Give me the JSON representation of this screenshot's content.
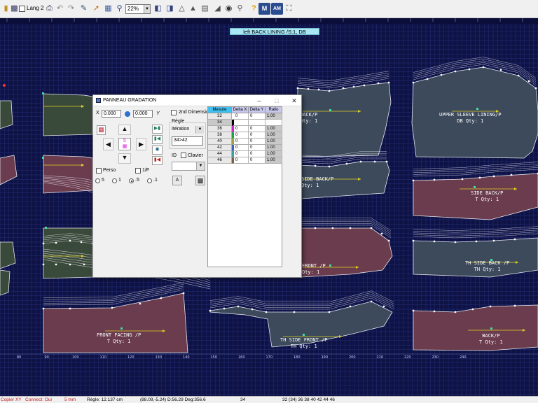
{
  "toolbar": {
    "lang_label": "Lang 2",
    "zoom_value": "22%",
    "m_label": "M",
    "am_label": "AM",
    "help_label": "?"
  },
  "canvas": {
    "top_label": "left BACK LINING /S:1, DB",
    "ruler_bottom": [
      "80",
      "90",
      "100",
      "110",
      "120",
      "130",
      "140",
      "150",
      "160",
      "170",
      "180",
      "190",
      "200",
      "210",
      "220",
      "230",
      "240"
    ],
    "pieces": [
      {
        "line1": "UPPER SLEEVE LINING/P",
        "line2": "DB Qty: 1"
      },
      {
        "line1": "BACK/P",
        "line2": "Qty: 1"
      },
      {
        "line1": "SIDE BACK/P",
        "line2": "Qty: 1"
      },
      {
        "line1": "SIDE BACK/P",
        "line2": "T Qty: 1"
      },
      {
        "line1": "FRONT /P",
        "line2": "Qty: 1"
      },
      {
        "line1": "TH SIDE BACK /P",
        "line2": "TH Qty: 1"
      },
      {
        "line1": "FRONT FACING /P",
        "line2": "T Qty: 1"
      },
      {
        "line1": "TH SIDE FRONT /P",
        "line2": "TH Qty: 1"
      },
      {
        "line1": "BACK/P",
        "line2": "T Qty: 1"
      }
    ]
  },
  "dialog": {
    "title": "PANNEAU GRADATION",
    "x_label": "X",
    "x_value": "0.000",
    "y_value": "0.000",
    "y_label": "Y",
    "second_dimension_label": "2nd Dimension",
    "regle_group": "Règle",
    "regle_combo": "Itération",
    "regle_input": "34>42",
    "perso_label": "Perso",
    "one_f_label": "1/F",
    "radios": [
      "5",
      "1",
      ".5",
      ".1"
    ],
    "id_label": "ID",
    "clavier_label": "Clavier",
    "a_button": "A",
    "center_label": "5",
    "grid": {
      "headers": [
        "Mesure",
        "Delta X",
        "Delta Y",
        "Ratio"
      ],
      "rows": [
        {
          "size": "32",
          "dx": "0",
          "dy": "0",
          "ratio": "1.00",
          "color": "#ffffff"
        },
        {
          "size": "34",
          "dx": "",
          "dy": "",
          "ratio": "",
          "color": "#000000"
        },
        {
          "size": "36",
          "dx": "0",
          "dy": "0",
          "ratio": "1.00",
          "color": "#d020d0"
        },
        {
          "size": "38",
          "dx": "0",
          "dy": "0",
          "ratio": "1.00",
          "color": "#20a040"
        },
        {
          "size": "40",
          "dx": "0",
          "dy": "0",
          "ratio": "1.00",
          "color": "#a0a040"
        },
        {
          "size": "42",
          "dx": "0",
          "dy": "0",
          "ratio": "1.00",
          "color": "#4060c0"
        },
        {
          "size": "44",
          "dx": "0",
          "dy": "0",
          "ratio": "1.00",
          "color": "#40a0a0"
        },
        {
          "size": "46",
          "dx": "0",
          "dy": "0",
          "ratio": "1.00",
          "color": "#806040"
        }
      ]
    }
  },
  "status": {
    "copier": "Copier XY",
    "connect": "Connect: Oui",
    "unit": "5 mm",
    "regle": "Règle: 12.137 cm",
    "coords": "(88.09,-5.24)  D:56.29  Deg:356.6",
    "size": "34",
    "sizes": "32 (34) 36 38 40 42 44 46"
  },
  "colors": {
    "canvas_bg": "#0e1244",
    "grid": "#27307a",
    "piece_dark": "#3a4a3a",
    "piece_rose": "#6a3c4e",
    "piece_slate": "#3c4a5c",
    "grade_lines": "#e8e8f0",
    "grainline": "#e0d020"
  }
}
